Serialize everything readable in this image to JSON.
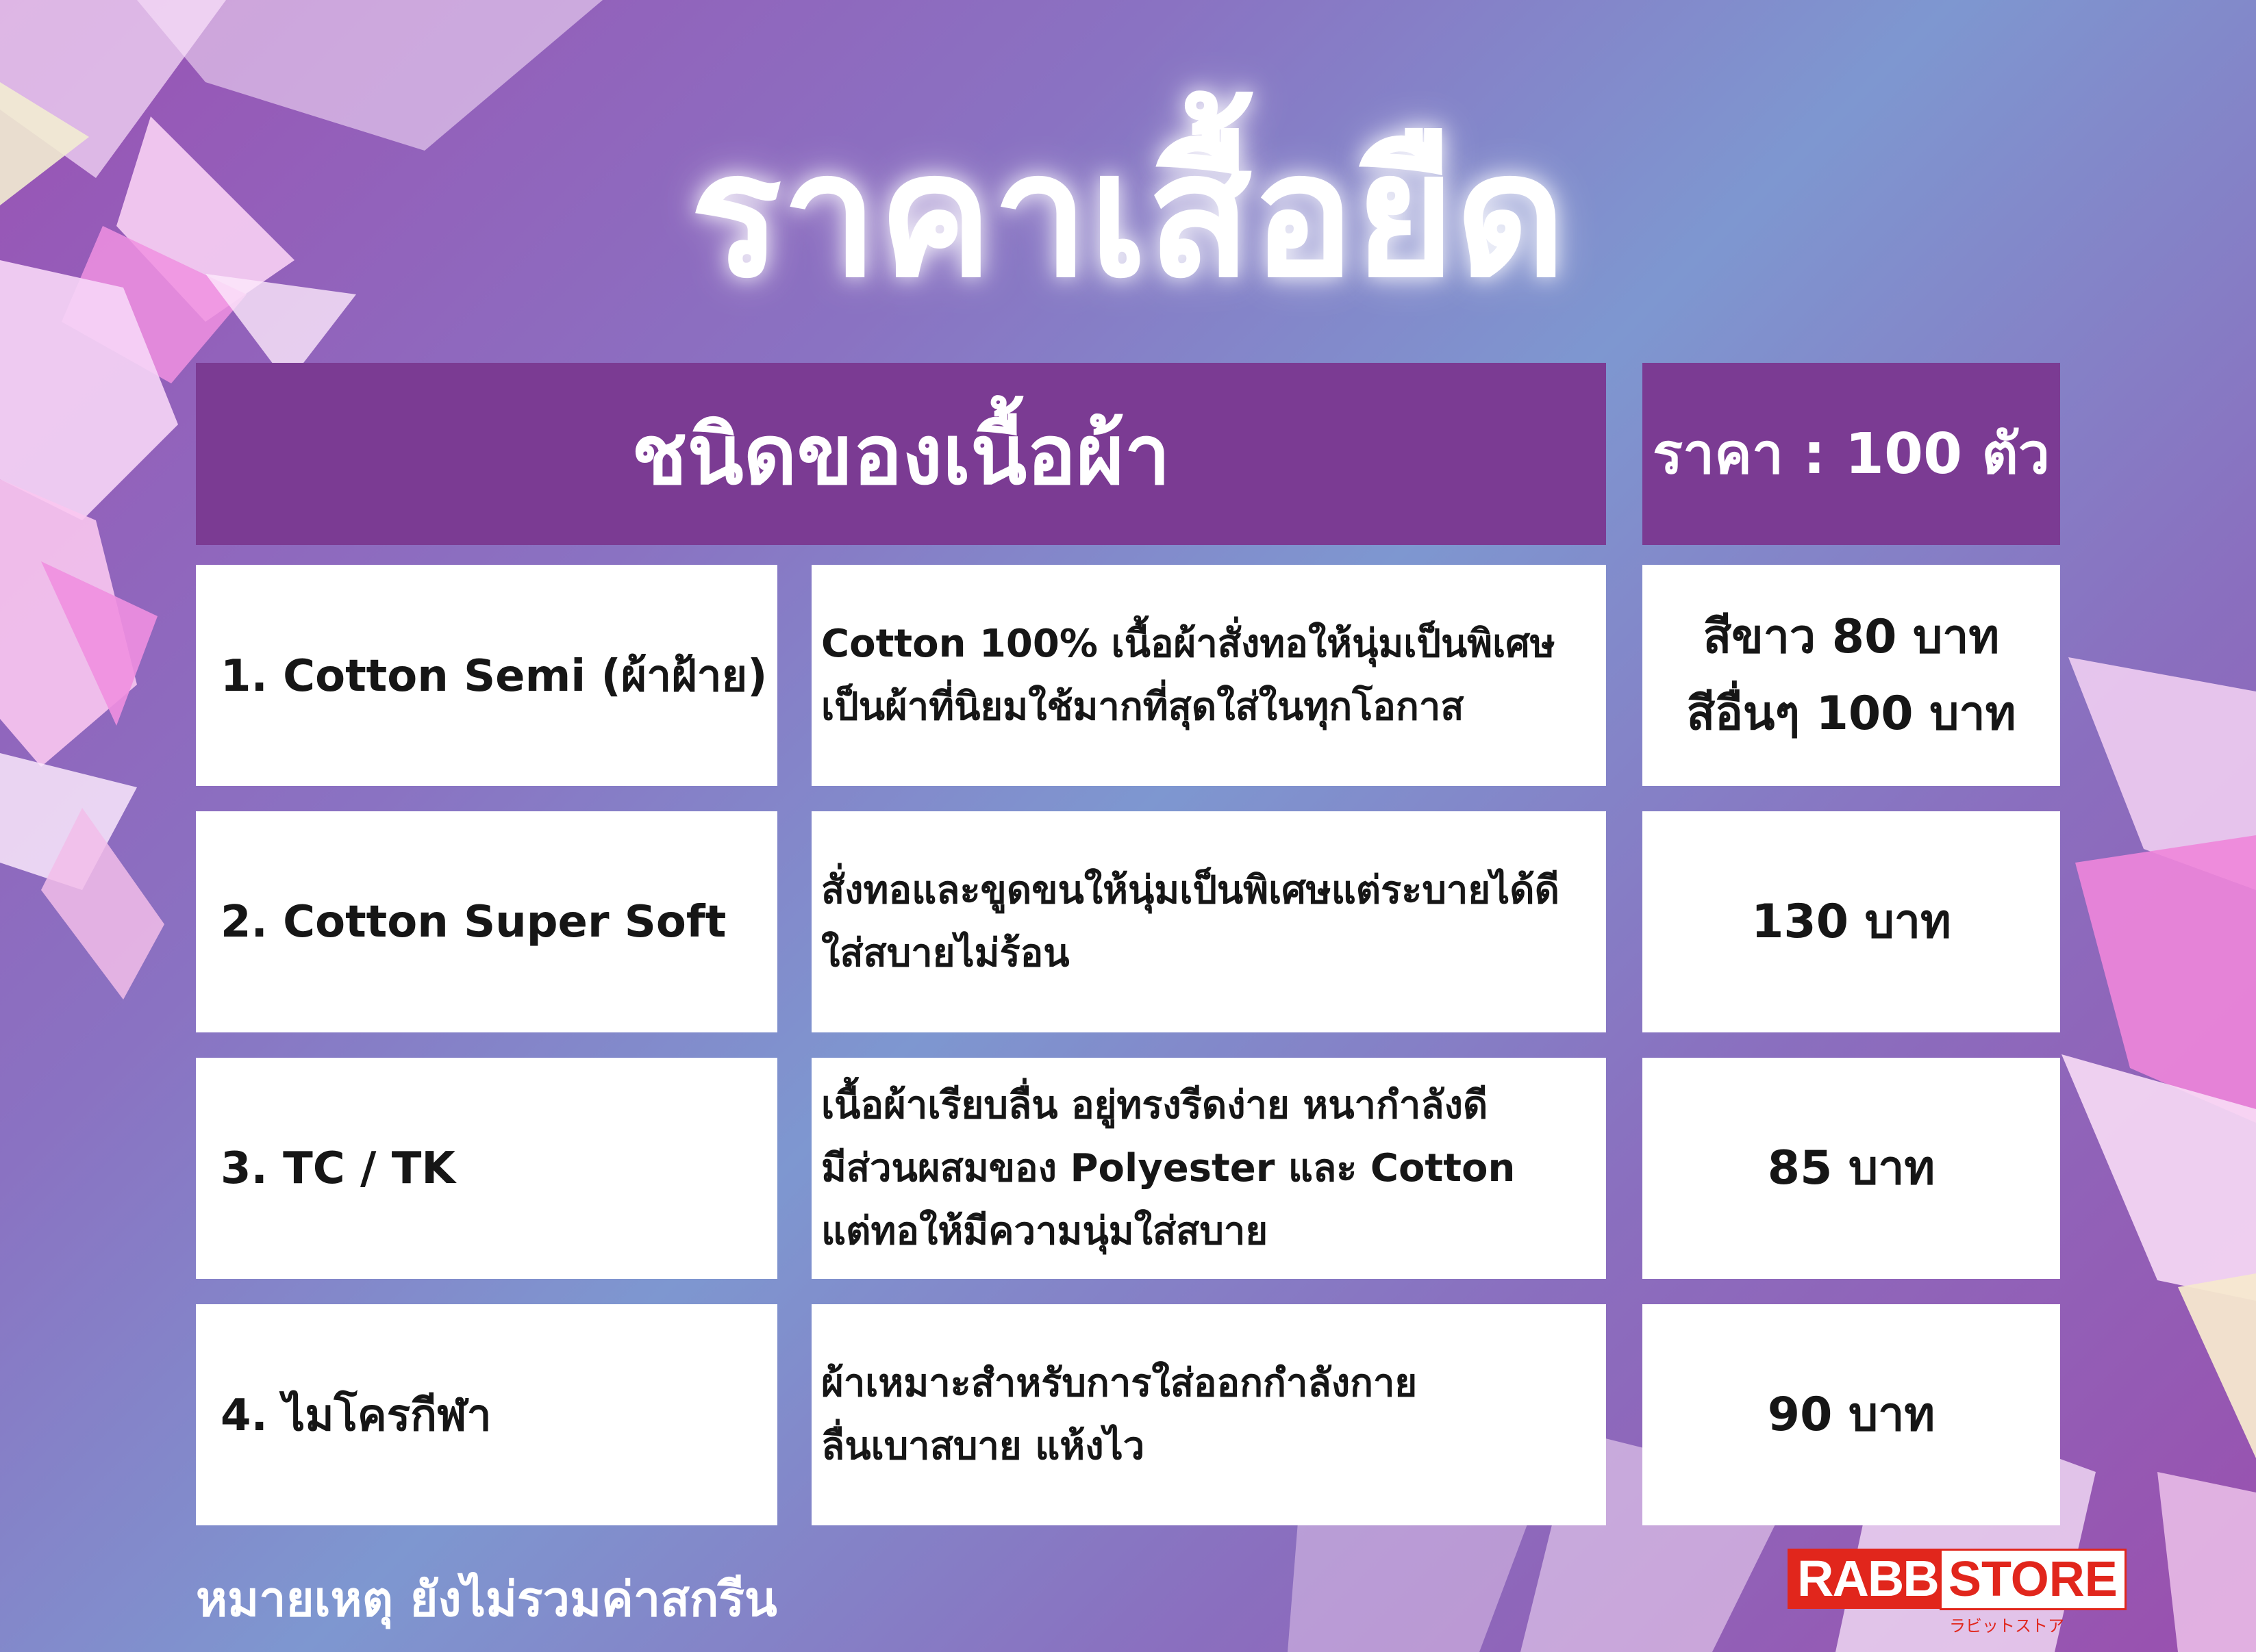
{
  "title": "ราคาเสื้อยืด",
  "header": {
    "type_label": "ชนิดของเนื้อผ้า",
    "price_label": "ราคา : 100 ตัว"
  },
  "rows": [
    {
      "name": "1. Cotton Semi (ผ้าฝ้าย)",
      "desc": [
        "Cotton 100% เนื้อผ้าสั่งทอให้นุ่มเป็นพิเศษ",
        "เป็นผ้าที่นิยมใช้มากที่สุดใส่ในทุกโอกาส"
      ],
      "price": [
        "สีขาว 80 บาท",
        "สีอื่นๆ 100 บาท"
      ]
    },
    {
      "name": "2. Cotton Super Soft",
      "desc": [
        "สั่งทอและขูดขนให้นุ่มเป็นพิเศษแต่ระบายได้ดี",
        "ใส่สบายไม่ร้อน"
      ],
      "price": [
        "130 บาท"
      ]
    },
    {
      "name": "3. TC / TK",
      "desc": [
        "เนื้อผ้าเรียบลื่น อยู่ทรงรีดง่าย หนากำลังดี",
        "มีส่วนผสมของ Polyester และ Cotton",
        "แต่ทอให้มีความนุ่มใส่สบาย"
      ],
      "price": [
        "85 บาท"
      ]
    },
    {
      "name": "4. ไมโครกีฬา",
      "desc": [
        "ผ้าเหมาะสำหรับการใส่ออกกำลังกาย",
        "ลื่นเบาสบาย แห้งไว"
      ],
      "price": [
        "90 บาท"
      ]
    }
  ],
  "note": "หมายเหตุ ยังไม่รวมค่าสกรีน",
  "logo": {
    "brand": "RABBITS",
    "store": "STORE",
    "sub": "ラビットストア"
  },
  "colors": {
    "header_bg": "#7b3b93",
    "cell_bg": "#ffffff",
    "logo_red": "#e1261c"
  }
}
